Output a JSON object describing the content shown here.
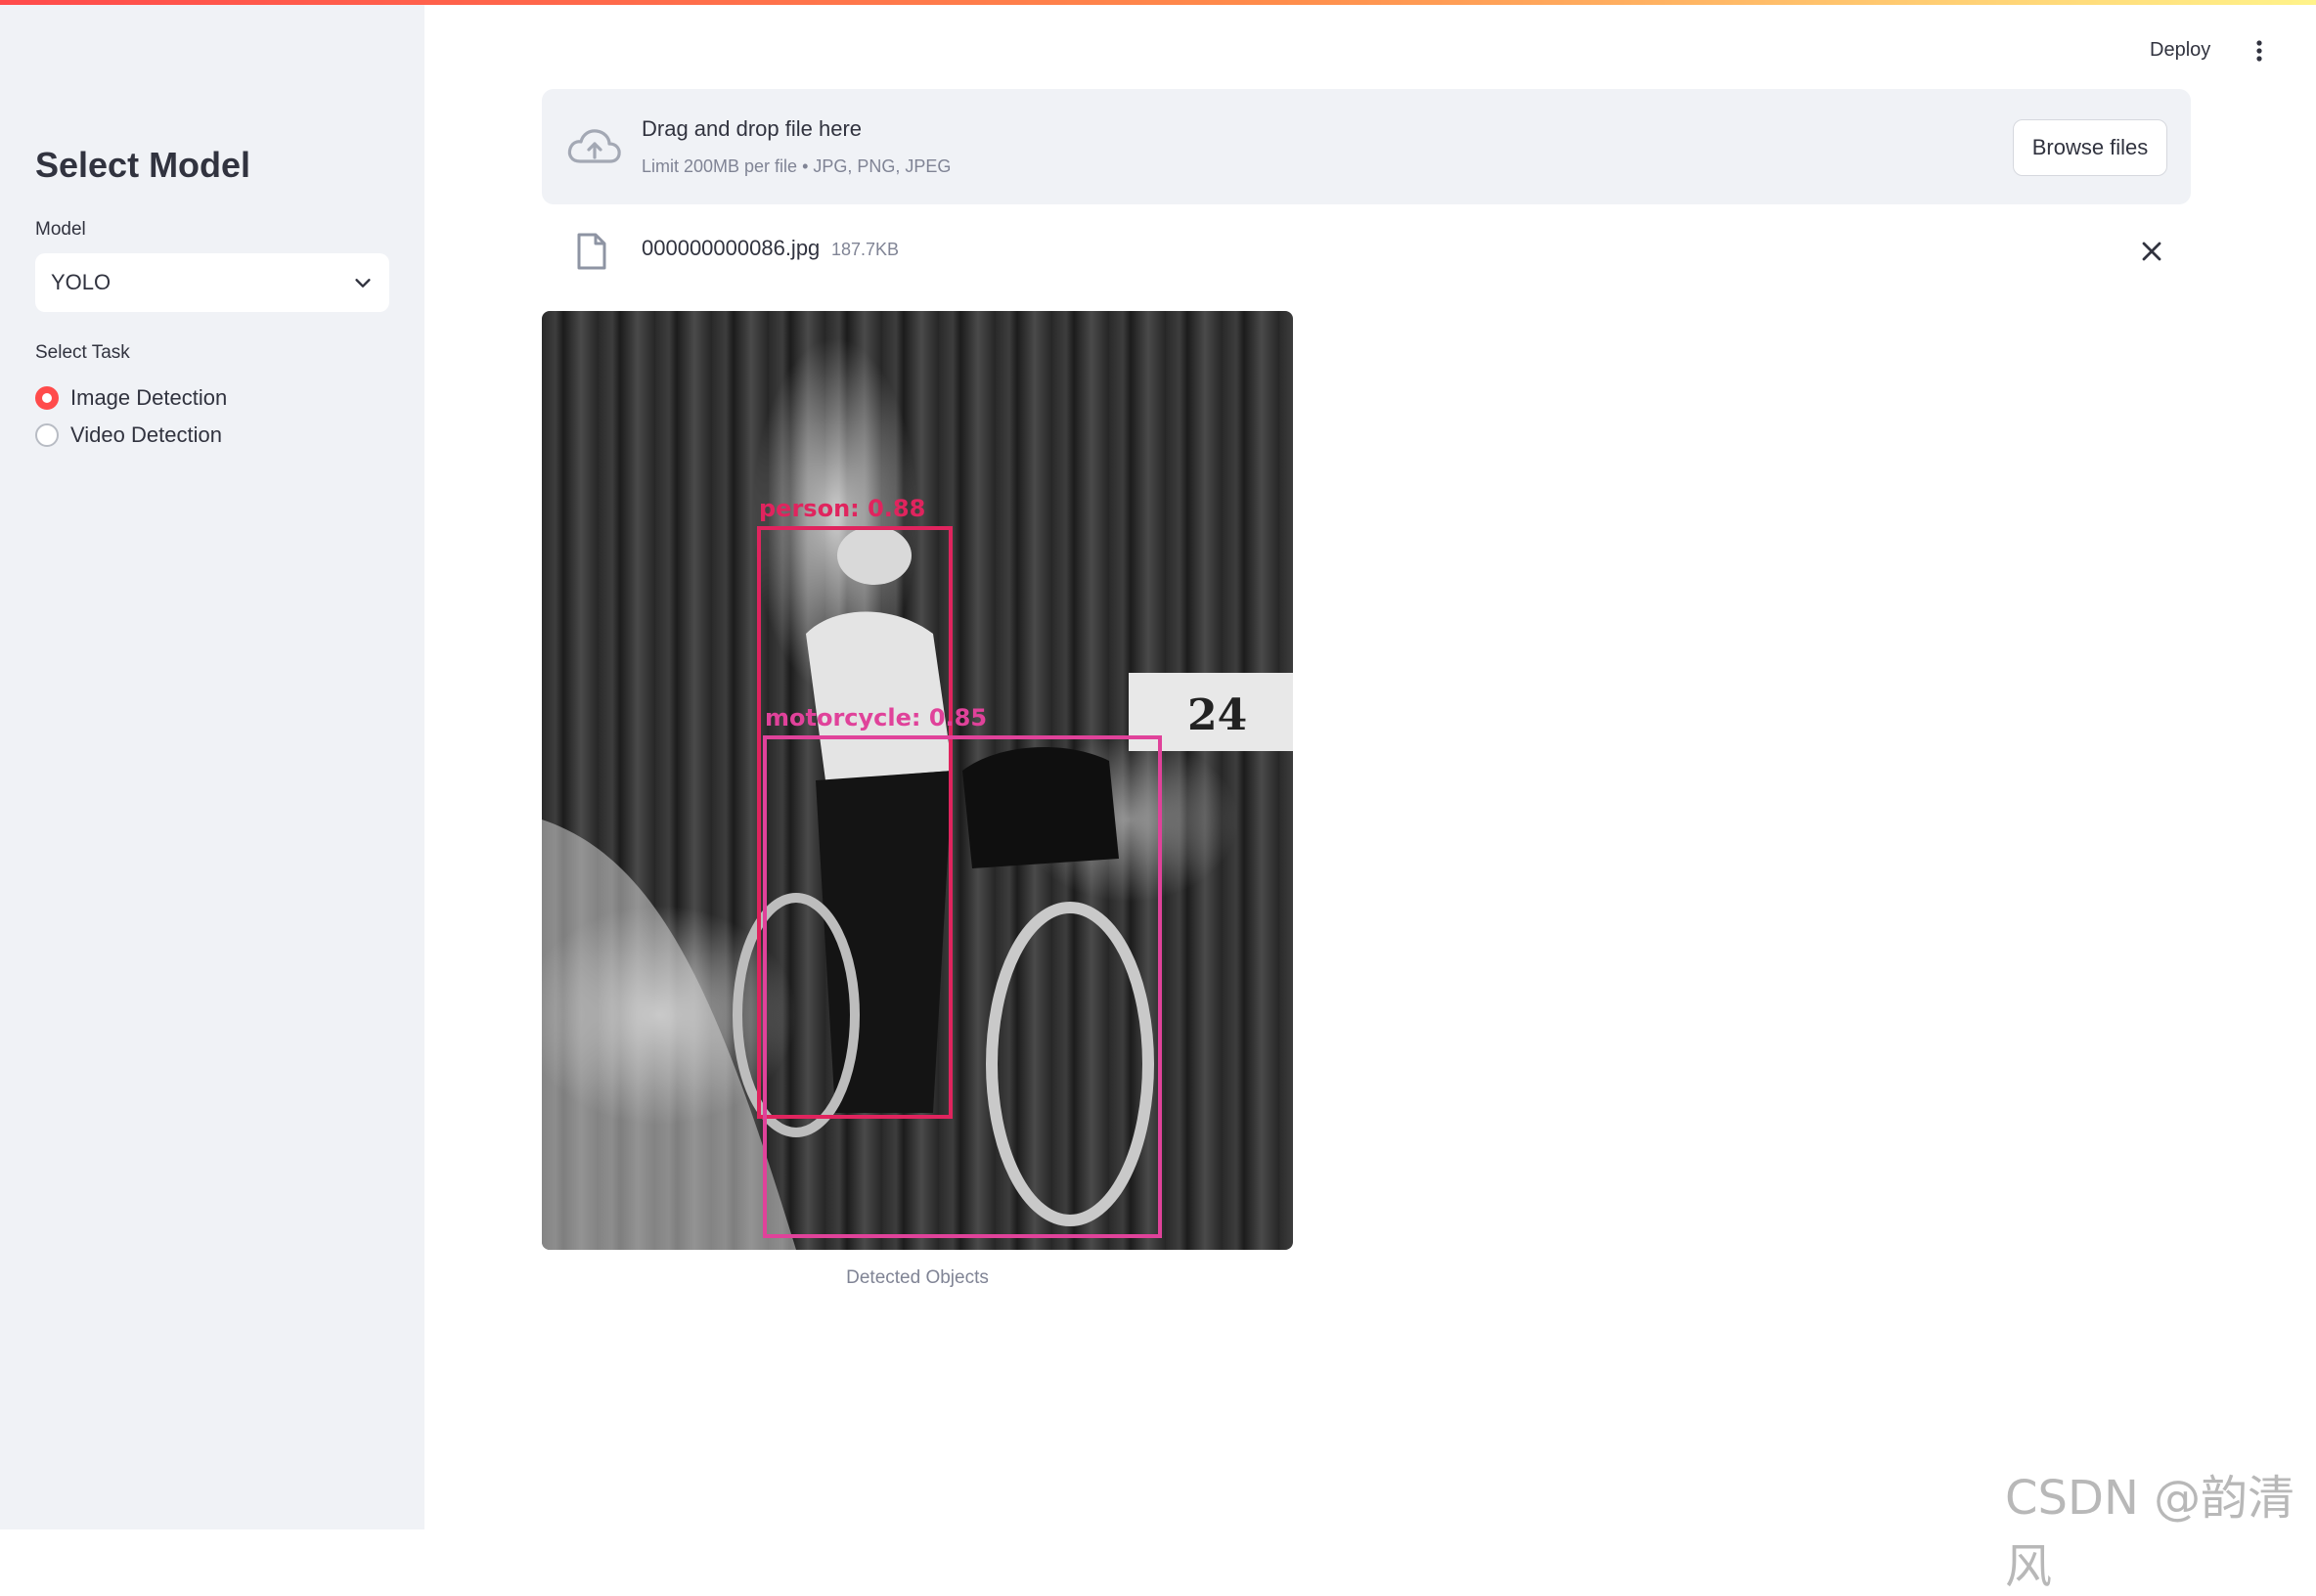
{
  "sidebar": {
    "title": "Select Model",
    "model_label": "Model",
    "model_value": "YOLO",
    "task_label": "Select Task",
    "tasks": [
      {
        "label": "Image Detection",
        "selected": true
      },
      {
        "label": "Video Detection",
        "selected": false
      }
    ]
  },
  "header": {
    "deploy_label": "Deploy",
    "menu_icon": "kebab-menu-icon"
  },
  "uploader": {
    "title": "Drag and drop file here",
    "subtitle": "Limit 200MB per file • JPG, PNG, JPEG",
    "browse_label": "Browse files",
    "icon": "cloud-upload-icon"
  },
  "uploaded_file": {
    "name": "000000000086.jpg",
    "size": "187.7KB",
    "icon": "file-icon",
    "remove_icon": "close-icon"
  },
  "result": {
    "detections": [
      {
        "label": "person: 0.88",
        "color": "#e0245e"
      },
      {
        "label": "motorcycle: 0.85",
        "color": "#e0429a"
      }
    ],
    "plate_text": "24",
    "caption": "Detected Objects"
  },
  "watermark": "CSDN @韵清风",
  "colors": {
    "accent": "#ff4b4b",
    "sidebar_bg": "#f0f2f6",
    "person_box": "#e0245e",
    "motorcycle_box": "#e0429a"
  }
}
